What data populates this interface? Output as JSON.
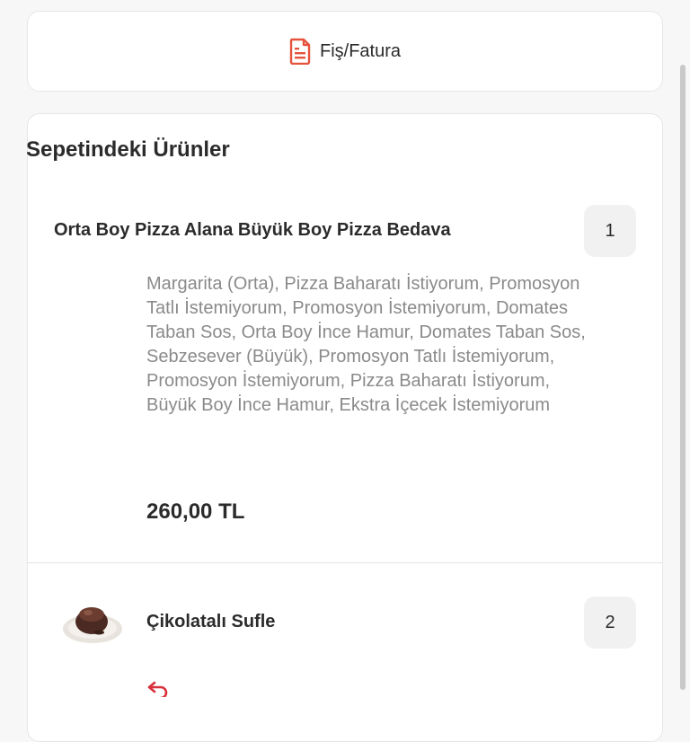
{
  "receipt": {
    "label": "Fiş/Fatura",
    "icon": "receipt-icon"
  },
  "cart": {
    "title": "Sepetindeki Ürünler",
    "items": [
      {
        "name": "Orta Boy Pizza Alana Büyük Boy Pizza Bedava",
        "quantity": "1",
        "description": "Margarita (Orta), Pizza Baharatı İstiyorum, Promosyon Tatlı İstemiyorum, Promosyon İstemiyorum, Domates Taban Sos, Orta Boy İnce Hamur, Domates Taban Sos, Sebzesever (Büyük), Promosyon Tatlı İstemiyorum, Promosyon İstemiyorum, Pizza Baharatı İstiyorum, Büyük Boy İnce Hamur, Ekstra İçecek İstemiyorum",
        "price": "260,00 TL"
      },
      {
        "name": "Çikolatalı Sufle",
        "quantity": "2",
        "image_icon": "souffle-plate-image"
      }
    ]
  },
  "colors": {
    "accent": "#e5533d",
    "action": "#d8303a",
    "muted_text": "#8a8a8a"
  }
}
